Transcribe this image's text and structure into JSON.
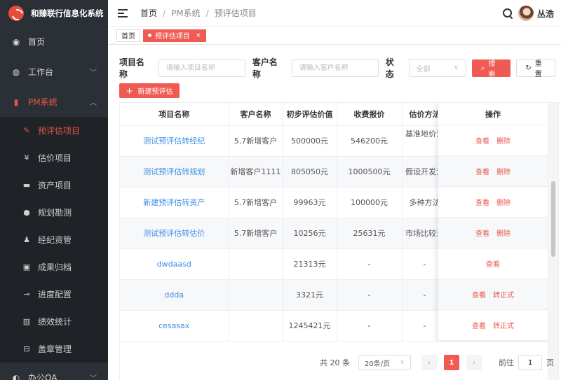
{
  "app": {
    "title": "和臻联行信息化系统"
  },
  "sidebar": {
    "items": [
      {
        "label": "首页",
        "icon": "dashboard-icon"
      },
      {
        "label": "工作台",
        "icon": "workbench-icon"
      },
      {
        "label": "PM系统",
        "icon": "bar-chart-icon"
      },
      {
        "label": "办公OA",
        "icon": "oa-icon"
      }
    ],
    "sub_items": [
      {
        "label": "预评估项目",
        "icon": "edit-icon"
      },
      {
        "label": "估价项目",
        "icon": "yen-icon"
      },
      {
        "label": "资产项目",
        "icon": "bag-icon"
      },
      {
        "label": "规划勘测",
        "icon": "globe-icon"
      },
      {
        "label": "经纪资管",
        "icon": "people-icon"
      },
      {
        "label": "成果归档",
        "icon": "archive-icon"
      },
      {
        "label": "进度配置",
        "icon": "progress-icon"
      },
      {
        "label": "绩效统计",
        "icon": "stats-icon"
      },
      {
        "label": "盖章管理",
        "icon": "stamp-icon"
      }
    ]
  },
  "header": {
    "breadcrumb": [
      "首页",
      "PM系统",
      "预评估项目"
    ],
    "user": "丛浩"
  },
  "tabs": [
    {
      "label": "首页"
    },
    {
      "label": "预评估项目"
    }
  ],
  "filters": {
    "project_label": "项目名称",
    "project_placeholder": "请输入项目名称",
    "client_label": "客户名称",
    "client_placeholder": "请输入客户名称",
    "status_label": "状态",
    "status_value": "全部",
    "search_btn": "搜索",
    "reset_btn": "重置"
  },
  "new_btn": "新建预评估",
  "table": {
    "columns": [
      "项目名称",
      "客户名称",
      "初步评估价值",
      "收费报价",
      "估价方法",
      "操作"
    ],
    "rows": [
      {
        "name": "测试预评估转经纪",
        "client": "5.7新增客户",
        "value": "500000元",
        "fee": "546200元",
        "method": "基准地价法",
        "ops": [
          "查看",
          "删除"
        ]
      },
      {
        "name": "测试预评估转规划",
        "client": "新增客户1111",
        "value": "805050元",
        "fee": "1000500元",
        "method": "假设开发法",
        "ops": [
          "查看",
          "删除"
        ]
      },
      {
        "name": "新建预评估转资产",
        "client": "5.7新增客户",
        "value": "99963元",
        "fee": "100000元",
        "method": "多种方法",
        "ops": [
          "查看",
          "删除"
        ]
      },
      {
        "name": "测试预评估转估价",
        "client": "5.7新增客户",
        "value": "10256元",
        "fee": "25631元",
        "method": "市场比较法",
        "ops": [
          "查看",
          "删除"
        ]
      },
      {
        "name": "dwdaasd",
        "client": "",
        "value": "21313元",
        "fee": "-",
        "method": "-",
        "ops": [
          "查看"
        ]
      },
      {
        "name": "ddda",
        "client": "",
        "value": "3321元",
        "fee": "-",
        "method": "-",
        "ops": [
          "查看",
          "转正式"
        ]
      },
      {
        "name": "cesasax",
        "client": "",
        "value": "1245421元",
        "fee": "-",
        "method": "-",
        "ops": [
          "查看",
          "转正式"
        ]
      }
    ]
  },
  "pagination": {
    "total": "共 20 条",
    "page_size": "20条/页",
    "current": "1",
    "goto_label": "前往",
    "goto_value": "1",
    "page_suffix": "页"
  },
  "colors": {
    "accent": "#ef5b52",
    "sidebar_bg": "#2b2f36",
    "link": "#3a8ee6"
  }
}
